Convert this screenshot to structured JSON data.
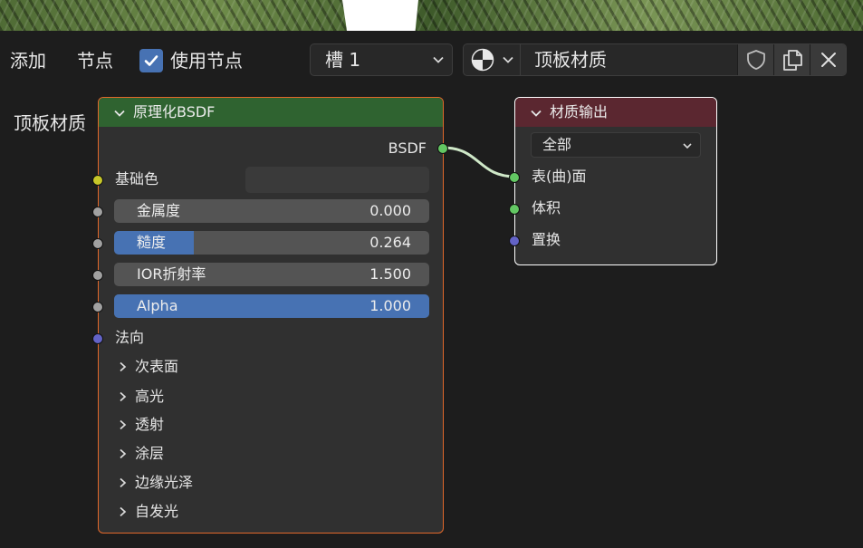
{
  "header": {
    "add_label": "添加",
    "node_label": "节点",
    "use_nodes_label": "使用节点",
    "use_nodes_checked": true,
    "slot_value": "槽 1",
    "material_name": "顶板材质"
  },
  "frame": {
    "label": "顶板材质"
  },
  "bsdf_node": {
    "title": "原理化BSDF",
    "output_label": "BSDF",
    "base_color_label": "基础色",
    "fields": [
      {
        "name": "金属度",
        "value": "0.000",
        "fraction": 0.0
      },
      {
        "name": "糙度",
        "value": "0.264",
        "fraction": 0.264
      },
      {
        "name": "IOR折射率",
        "value": "1.500",
        "fraction": 0.0
      },
      {
        "name": "Alpha",
        "value": "1.000",
        "fraction": 1.0
      }
    ],
    "normal_label": "法向",
    "panels": [
      "次表面",
      "高光",
      "透射",
      "涂层",
      "边缘光泽",
      "自发光"
    ]
  },
  "output_node": {
    "title": "材质输出",
    "target_value": "全部",
    "inputs": [
      "表(曲)面",
      "体积",
      "置换"
    ]
  },
  "colors": {
    "bsdf_header": "#2f6330",
    "output_header": "#5b2730",
    "bsdf_border": "#e2682a",
    "accent": "#4772b3",
    "socket_shader": "#63c763",
    "socket_color": "#c7c729",
    "socket_float": "#a1a1a1",
    "socket_vector": "#6363c7"
  }
}
